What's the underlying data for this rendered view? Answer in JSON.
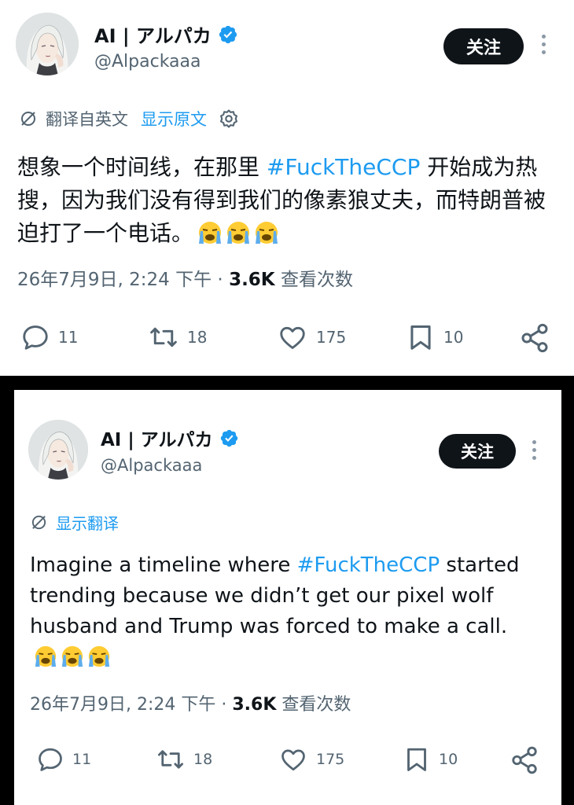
{
  "posts": [
    {
      "author_name": "AI | アルパカ",
      "handle": "@Alpackaaa",
      "follow_label": "关注",
      "translation": {
        "note": "翻译自英文",
        "link": "显示原文"
      },
      "text_before": "想象一个时间线，在那里 ",
      "hashtag": "#FuckTheCCP",
      "text_after": " 开始成为热搜，因为我们没有得到我们的像素狼丈夫，而特朗普被迫打了一个电话。",
      "emoji": [
        "loudly-crying-face-emoji",
        "loudly-crying-face-emoji",
        "loudly-crying-face-emoji"
      ],
      "timestamp": "26年7月9日, 2:24 下午",
      "separator": " · ",
      "views": "3.6K",
      "views_label": " 查看次数",
      "stats": {
        "replies": "11",
        "reposts": "18",
        "likes": "175",
        "bookmarks": "10"
      }
    },
    {
      "author_name": "AI | アルパカ",
      "handle": "@Alpackaaa",
      "follow_label": "关注",
      "translation": {
        "link": "显示翻译"
      },
      "text_before": "Imagine a timeline where ",
      "hashtag": "#FuckTheCCP",
      "text_after": " started trending because we didn’t get our pixel wolf husband and Trump was forced to make a call.",
      "emoji": [
        "loudly-crying-face-emoji",
        "loudly-crying-face-emoji",
        "loudly-crying-face-emoji"
      ],
      "timestamp": "26年7月9日, 2:24 下午",
      "separator": " · ",
      "views": "3.6K",
      "views_label": " 查看次数",
      "stats": {
        "replies": "11",
        "reposts": "18",
        "likes": "175",
        "bookmarks": "10"
      }
    }
  ],
  "colors": {
    "accent": "#1d9bf0",
    "text": "#0f1419",
    "muted": "#536471",
    "follow_bg": "#0f1419",
    "verified": "#1d9bf0"
  },
  "icons": [
    "verified-badge-icon",
    "more-icon",
    "translate-icon",
    "settings-icon",
    "reply-icon",
    "repost-icon",
    "like-icon",
    "bookmark-icon",
    "share-icon"
  ]
}
